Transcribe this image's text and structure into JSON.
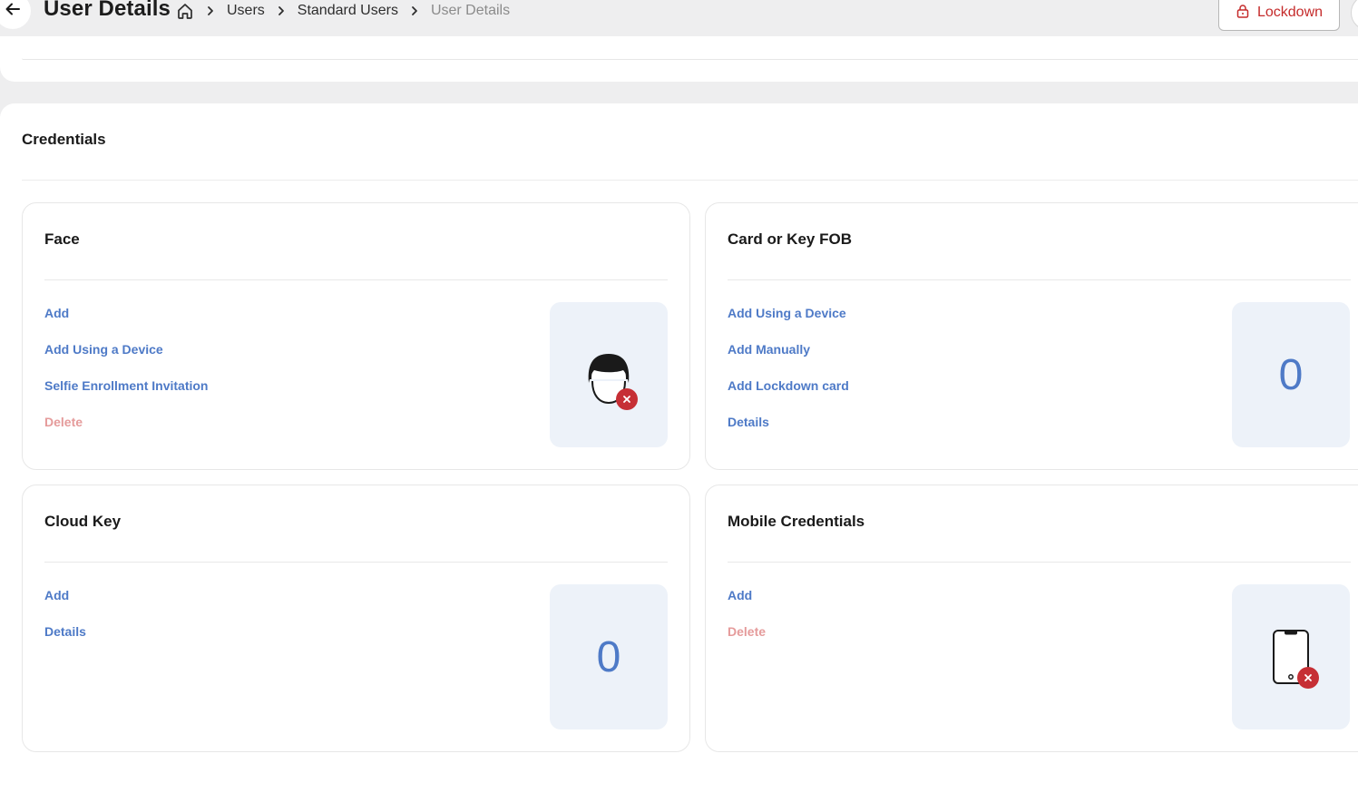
{
  "header": {
    "title": "User Details",
    "breadcrumb": {
      "home_icon": "home-icon",
      "items": [
        "Users",
        "Standard Users"
      ],
      "current": "User Details"
    },
    "lockdown_label": "Lockdown"
  },
  "credentials": {
    "title": "Credentials",
    "cards": {
      "face": {
        "title": "Face",
        "actions": [
          "Add",
          "Add Using a Device",
          "Selfie Enrollment Invitation"
        ],
        "delete_label": "Delete",
        "status_icon": "face-not-enrolled-icon"
      },
      "card_fob": {
        "title": "Card or Key FOB",
        "actions": [
          "Add Using a Device",
          "Add Manually",
          "Add Lockdown card",
          "Details"
        ],
        "count": "0"
      },
      "cloud_key": {
        "title": "Cloud Key",
        "actions": [
          "Add",
          "Details"
        ],
        "count": "0"
      },
      "mobile": {
        "title": "Mobile Credentials",
        "actions": [
          "Add"
        ],
        "delete_label": "Delete",
        "status_icon": "mobile-not-enrolled-icon"
      }
    }
  },
  "colors": {
    "link_blue": "#4e7ac7",
    "delete_pink": "#e59b9b",
    "danger_red": "#c62f35",
    "tile_bg": "#edf2f9"
  }
}
